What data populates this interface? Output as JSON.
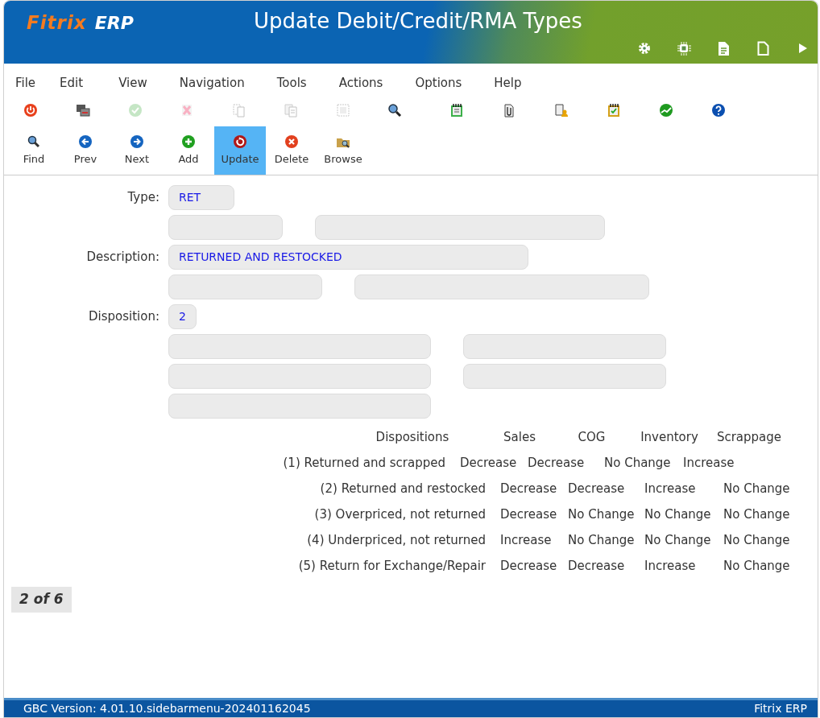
{
  "header": {
    "logo_main": "Fitrix",
    "logo_sub": "ERP",
    "title": "Update Debit/Credit/RMA Types",
    "icons": [
      {
        "kind": "gear"
      },
      {
        "kind": "chip"
      },
      {
        "kind": "doc"
      },
      {
        "kind": "page"
      },
      {
        "kind": "play"
      }
    ]
  },
  "menu": [
    "File",
    "Edit",
    "View",
    "Navigation",
    "Tools",
    "Actions",
    "Options",
    "Help"
  ],
  "toolbar_icons": [
    {
      "kind": "power",
      "disabled": false
    },
    {
      "kind": "windows",
      "disabled": false
    },
    {
      "kind": "accept",
      "disabled": true
    },
    {
      "kind": "cancel",
      "disabled": true
    },
    {
      "kind": "copy",
      "disabled": true
    },
    {
      "kind": "paste",
      "disabled": true
    },
    {
      "kind": "select",
      "disabled": true
    },
    {
      "kind": "zoom",
      "disabled": false
    },
    {
      "kind": "notes",
      "disabled": false
    },
    {
      "kind": "attach",
      "disabled": false
    },
    {
      "kind": "docuser",
      "disabled": false
    },
    {
      "kind": "checklist",
      "disabled": false
    },
    {
      "kind": "trend",
      "disabled": false
    },
    {
      "kind": "help",
      "disabled": false
    }
  ],
  "actions": [
    {
      "label": "Find",
      "kind": "find",
      "selected": false
    },
    {
      "label": "Prev",
      "kind": "prev",
      "selected": false
    },
    {
      "label": "Next",
      "kind": "next",
      "selected": false
    },
    {
      "label": "Add",
      "kind": "add",
      "selected": false
    },
    {
      "label": "Update",
      "kind": "update",
      "selected": true
    },
    {
      "label": "Delete",
      "kind": "delete",
      "selected": false
    },
    {
      "label": "Browse",
      "kind": "browse",
      "selected": false
    }
  ],
  "form_rows": [
    {
      "label": "Type:",
      "fields": [
        {
          "kind": "value",
          "value": "RET"
        }
      ]
    },
    {
      "fields": [
        {
          "kind": "blank"
        },
        {
          "kind": "blank"
        }
      ]
    },
    {
      "label": "Description:",
      "fields": [
        {
          "kind": "value",
          "value": "RETURNED AND RESTOCKED"
        }
      ]
    },
    {
      "fields": [
        {
          "kind": "blank"
        },
        {
          "kind": "blank"
        }
      ]
    },
    {
      "label": "Disposition:",
      "fields": [
        {
          "kind": "value",
          "value": "2"
        }
      ]
    },
    {
      "fields": [
        {
          "kind": "blank"
        },
        {
          "kind": "blank"
        }
      ]
    },
    {
      "fields": [
        {
          "kind": "blank"
        },
        {
          "kind": "blank"
        }
      ]
    },
    {
      "fields": [
        {
          "kind": "blank"
        }
      ]
    }
  ],
  "dispositions": {
    "columns": [
      "Dispositions",
      "Sales",
      "COG",
      "Inventory",
      "Scrappage"
    ],
    "rows": [
      [
        "(1) Returned and scrapped",
        "Decrease",
        "Decrease",
        "No Change",
        "Increase"
      ],
      [
        "(2) Returned and restocked",
        "Decrease",
        "Decrease",
        "Increase",
        "No Change"
      ],
      [
        "(3) Overpriced, not returned",
        "Decrease",
        "No Change",
        "No Change",
        "No Change"
      ],
      [
        "(4) Underpriced, not returned",
        "Increase",
        "No Change",
        "No Change",
        "No Change"
      ],
      [
        "(5) Return for Exchange/Repair",
        "Decrease",
        "Decrease",
        "Increase",
        "No Change"
      ]
    ]
  },
  "record_counter": "2 of 6",
  "status_bar": {
    "version": "GBC Version: 4.01.10.sidebarmenu-202401162045",
    "app": "Fitrix ERP"
  }
}
